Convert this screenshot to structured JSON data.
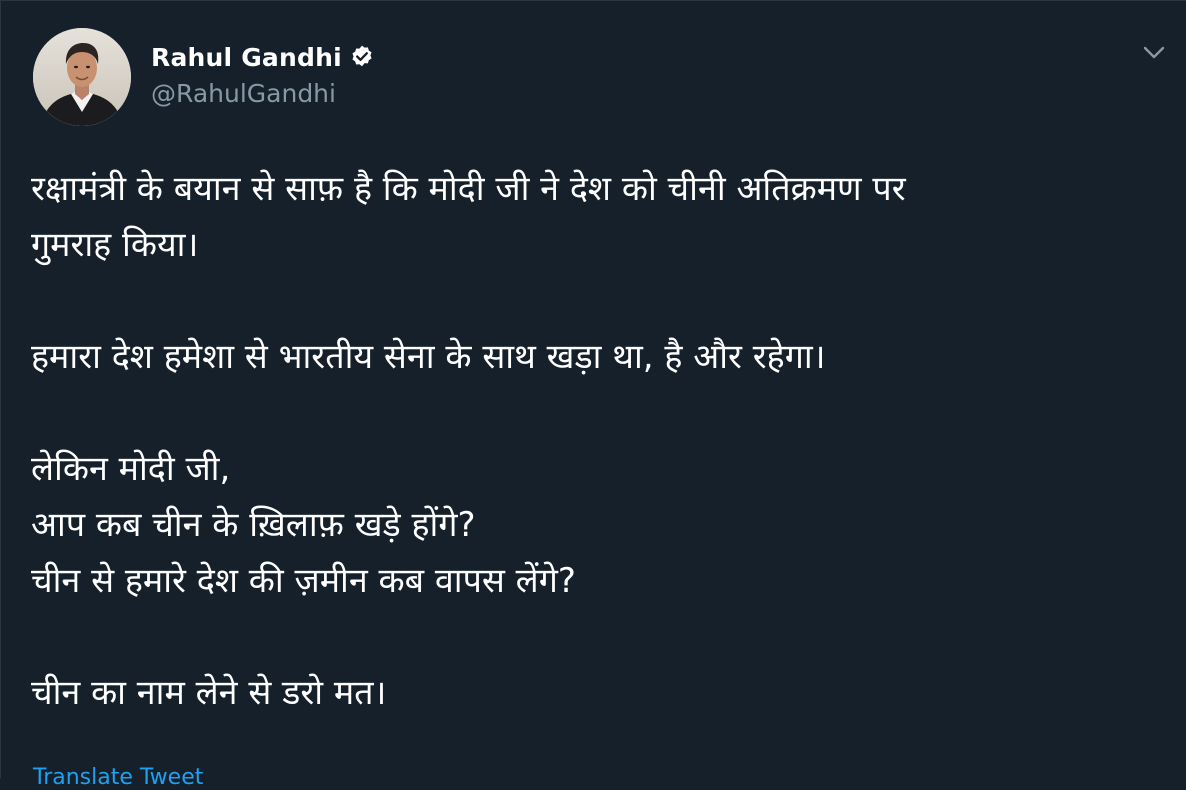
{
  "author": {
    "display_name": "Rahul Gandhi",
    "handle": "@RahulGandhi",
    "verified": true
  },
  "icons": {
    "verified": "verified-badge-icon",
    "caret": "chevron-down-icon"
  },
  "tweet": {
    "paragraphs": [
      [
        "रक्षामंत्री के बयान से साफ़ है कि मोदी जी ने देश को चीनी अतिक्रमण पर",
        "गुमराह किया।"
      ],
      [
        "हमारा देश हमेशा से भारतीय सेना के साथ खड़ा था, है और रहेगा।"
      ],
      [
        "लेकिन मोदी जी,",
        "आप कब चीन के ख़िलाफ़ खड़े होंगे?",
        "चीन से हमारे देश की ज़मीन कब वापस लेंगे?"
      ],
      [
        "चीन का नाम लेने से डरो मत।"
      ]
    ],
    "translate_label": "Translate Tweet"
  },
  "colors": {
    "background": "#15202b",
    "text": "#ffffff",
    "secondary_text": "#8899a6",
    "accent": "#1da1f2"
  }
}
